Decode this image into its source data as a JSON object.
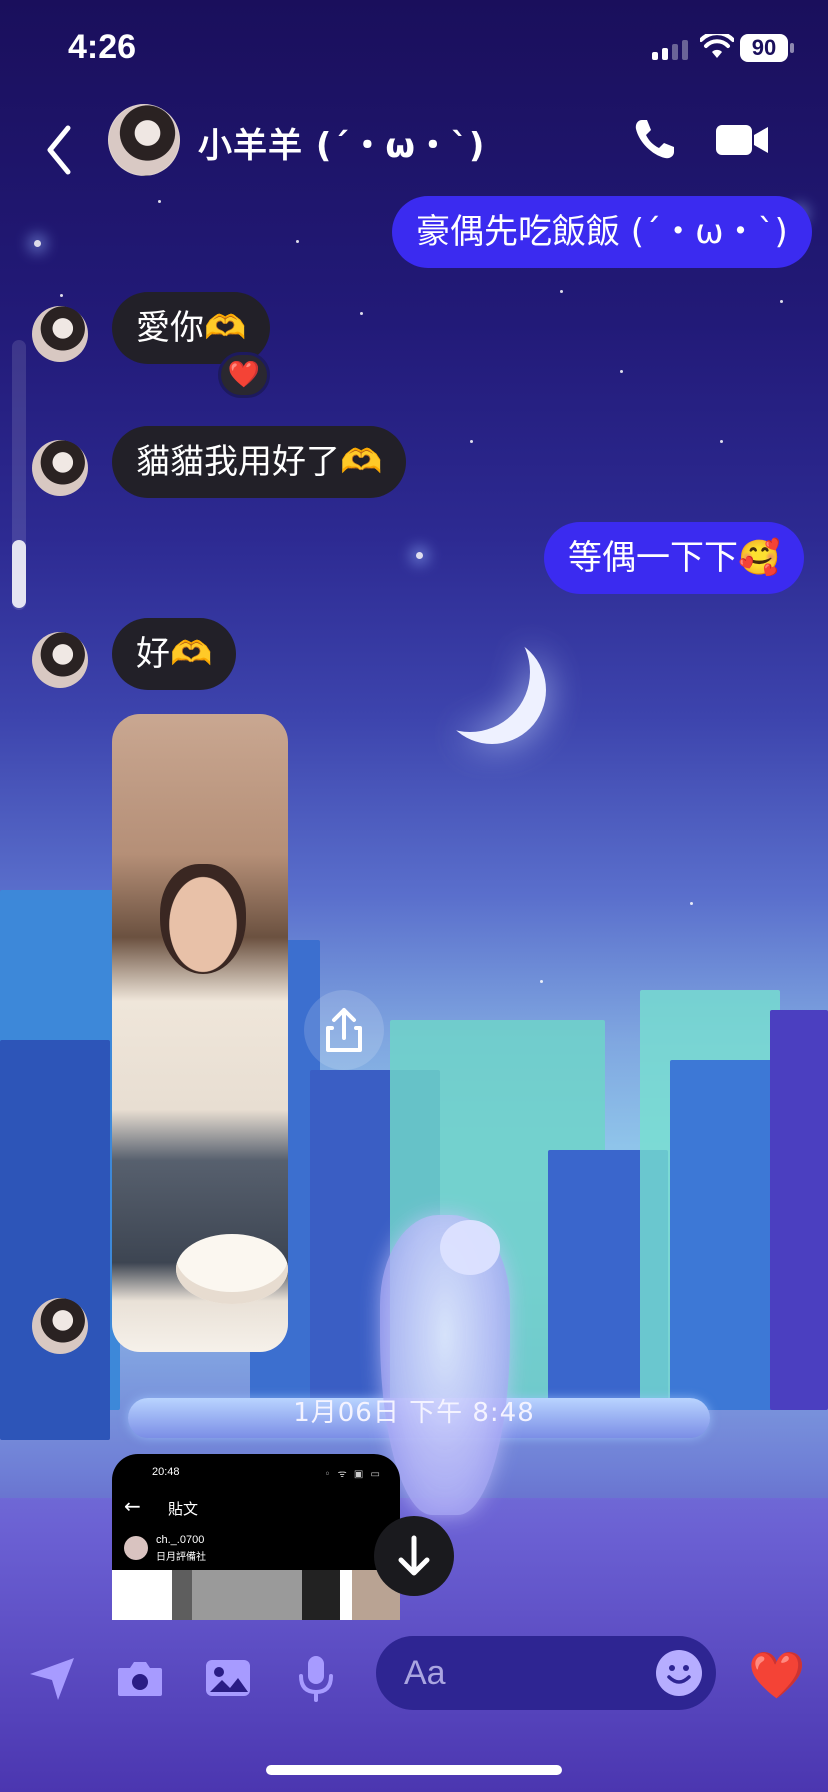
{
  "status_bar": {
    "time": "4:26",
    "battery": "90"
  },
  "header": {
    "contact_name": "小羊羊 (´・ω・`)",
    "back_icon": "chevron-left-icon",
    "call_icon": "phone-icon",
    "video_icon": "video-camera-icon"
  },
  "messages": [
    {
      "direction": "out",
      "text": "豪偶先吃飯飯 (´・ω・`)"
    },
    {
      "direction": "in",
      "text": "愛你🫶",
      "reaction": "❤️"
    },
    {
      "direction": "in",
      "text": "貓貓我用好了🫶"
    },
    {
      "direction": "out",
      "text": "等偶一下下🥰"
    },
    {
      "direction": "in",
      "text": "好🫶"
    },
    {
      "direction": "in",
      "type": "photo"
    }
  ],
  "timestamp": "1月06日 下午 8:48",
  "shared_preview": {
    "status_time": "20:48",
    "status_icons": "◦ ᯤ ▣ ▭",
    "title": "貼文",
    "username": "ch._.0700",
    "subtitle": "日月評備社"
  },
  "composer": {
    "placeholder": "Aa",
    "icons": [
      "location-arrow-icon",
      "camera-icon",
      "photo-icon",
      "microphone-icon",
      "emoji-icon",
      "heart-icon"
    ],
    "quick_reaction": "❤️"
  },
  "colors": {
    "outgoing_bubble": "#3b2bf0",
    "incoming_bubble": "#222028",
    "composer_field": "#2e2592",
    "heart": "#ea2a3b"
  }
}
